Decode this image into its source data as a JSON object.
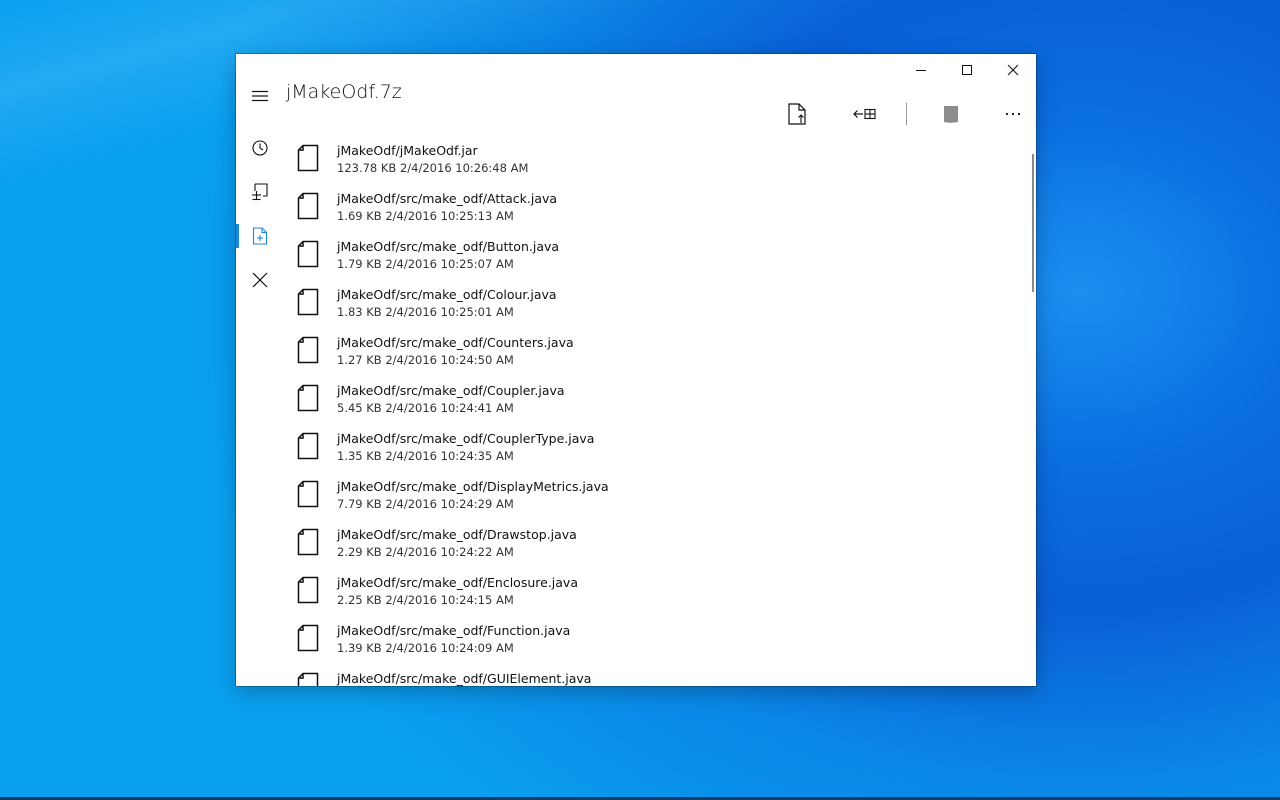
{
  "window": {
    "title": "jMakeOdf.7z",
    "controls": {
      "minimize": "minimize-icon",
      "maximize": "maximize-icon",
      "close": "close-icon"
    }
  },
  "toolbar": {
    "items": [
      "extract-file-icon",
      "extract-all-icon",
      "separator",
      "stop-icon",
      "more-icon"
    ],
    "more_label": "···"
  },
  "nav": {
    "items": [
      "recent-icon",
      "open-archive-icon",
      "archive-contents-icon",
      "close-archive-icon"
    ],
    "selected_index": 2,
    "accent_color": "#1e88d8"
  },
  "files": [
    {
      "name": "jMakeOdf/jMakeOdf.jar",
      "meta": "123.78 KB 2/4/2016 10:26:48 AM"
    },
    {
      "name": "jMakeOdf/src/make_odf/Attack.java",
      "meta": "1.69 KB 2/4/2016 10:25:13 AM"
    },
    {
      "name": "jMakeOdf/src/make_odf/Button.java",
      "meta": "1.79 KB 2/4/2016 10:25:07 AM"
    },
    {
      "name": "jMakeOdf/src/make_odf/Colour.java",
      "meta": "1.83 KB 2/4/2016 10:25:01 AM"
    },
    {
      "name": "jMakeOdf/src/make_odf/Counters.java",
      "meta": "1.27 KB 2/4/2016 10:24:50 AM"
    },
    {
      "name": "jMakeOdf/src/make_odf/Coupler.java",
      "meta": "5.45 KB 2/4/2016 10:24:41 AM"
    },
    {
      "name": "jMakeOdf/src/make_odf/CouplerType.java",
      "meta": "1.35 KB 2/4/2016 10:24:35 AM"
    },
    {
      "name": "jMakeOdf/src/make_odf/DisplayMetrics.java",
      "meta": "7.79 KB 2/4/2016 10:24:29 AM"
    },
    {
      "name": "jMakeOdf/src/make_odf/Drawstop.java",
      "meta": "2.29 KB 2/4/2016 10:24:22 AM"
    },
    {
      "name": "jMakeOdf/src/make_odf/Enclosure.java",
      "meta": "2.25 KB 2/4/2016 10:24:15 AM"
    },
    {
      "name": "jMakeOdf/src/make_odf/Function.java",
      "meta": "1.39 KB 2/4/2016 10:24:09 AM"
    },
    {
      "name": "jMakeOdf/src/make_odf/GUIElement.java",
      "meta": ""
    }
  ]
}
